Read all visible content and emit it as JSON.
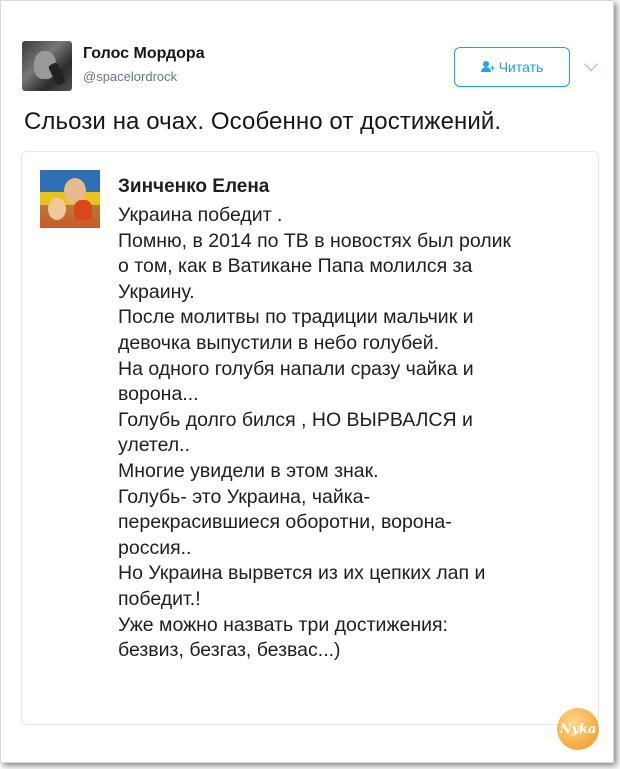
{
  "tweet": {
    "display_name": "Голос Мордора",
    "handle": "@spacelordrock",
    "follow_label": "Читать",
    "text": "Сльози на очах. Особенно от достижений."
  },
  "quote": {
    "author": "Зинченко Елена",
    "lines": [
      "Украина победит .",
      "Помню, в 2014 по ТВ в новостях был ролик",
      "о том, как в Ватикане Папа молился за",
      "Украину.",
      "После молитвы по традиции мальчик и",
      "девочка выпустили в небо голубей.",
      "На одного голубя напали сразу чайка и",
      "ворона...",
      "Голубь долго бился , НО ВЫРВАЛСЯ и",
      "улетел..",
      "Многие увидели в этом знак.",
      "Голубь- это Украина, чайка-",
      "перекрасившиеся оборотни, ворона-",
      "россия..",
      "Но Украина вырвется из их цепких лап и",
      "победит.!",
      "Уже можно назвать три достижения:",
      "безвиз, безгаз, безвас...)"
    ]
  },
  "watermark": {
    "text": "Nyka"
  },
  "colors": {
    "accent": "#1da1f2",
    "text": "#14171a",
    "muted": "#657786"
  }
}
